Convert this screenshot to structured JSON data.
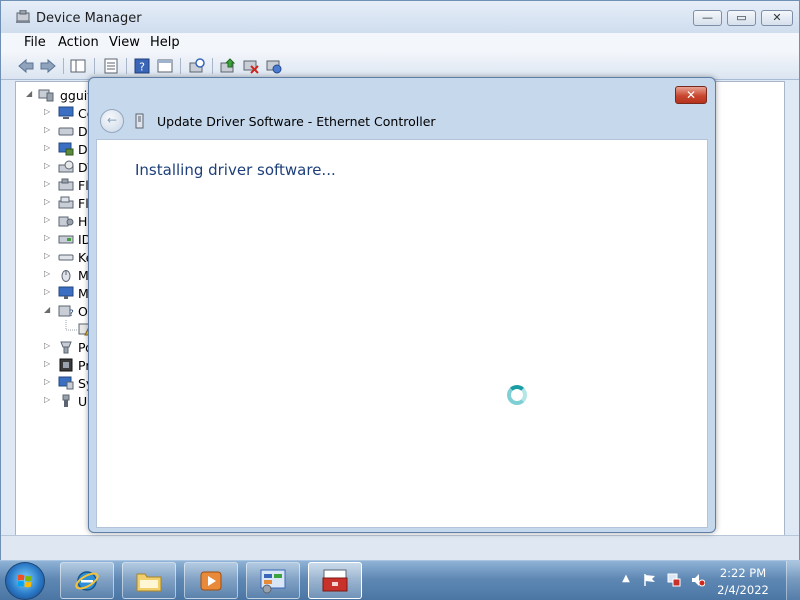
{
  "window": {
    "title": "Device Manager",
    "buttons": {
      "minimize": "—",
      "maximize": "▭",
      "close": "✕"
    }
  },
  "menu": {
    "items": [
      "File",
      "Action",
      "View",
      "Help"
    ]
  },
  "toolbar": {
    "icons": [
      "back-arrow-icon",
      "forward-arrow-icon",
      "console-tree-icon",
      "properties-icon",
      "help-icon",
      "show-hide-icon",
      "scan-hardware-icon",
      "update-driver-icon",
      "disable-device-icon",
      "uninstall-device-icon"
    ]
  },
  "tree": {
    "root": {
      "label": "gguiti",
      "arrow": "◢"
    },
    "items": [
      {
        "label": "Co",
        "arrow": "▷",
        "icon": "computer-icon"
      },
      {
        "label": "Di",
        "arrow": "▷",
        "icon": "disk-drive-icon"
      },
      {
        "label": "Di",
        "arrow": "▷",
        "icon": "display-adapter-icon"
      },
      {
        "label": "DV",
        "arrow": "▷",
        "icon": "dvd-drive-icon"
      },
      {
        "label": "Fl",
        "arrow": "▷",
        "icon": "floppy-controller-icon"
      },
      {
        "label": "Fl",
        "arrow": "▷",
        "icon": "floppy-drive-icon"
      },
      {
        "label": "Hu",
        "arrow": "▷",
        "icon": "hid-icon"
      },
      {
        "label": "ID",
        "arrow": "▷",
        "icon": "ide-controller-icon"
      },
      {
        "label": "Ke",
        "arrow": "▷",
        "icon": "keyboard-icon"
      },
      {
        "label": "Mi",
        "arrow": "▷",
        "icon": "mouse-icon"
      },
      {
        "label": "Mo",
        "arrow": "▷",
        "icon": "monitor-icon"
      },
      {
        "label": "Ot",
        "arrow": "◢",
        "icon": "other-devices-icon"
      },
      {
        "label": "",
        "arrow": "",
        "icon": "warning-device-icon"
      },
      {
        "label": "Po",
        "arrow": "▷",
        "icon": "ports-icon"
      },
      {
        "label": "Pr",
        "arrow": "▷",
        "icon": "processor-icon"
      },
      {
        "label": "Sy",
        "arrow": "▷",
        "icon": "system-devices-icon"
      },
      {
        "label": "Ur",
        "arrow": "▷",
        "icon": "usb-controller-icon"
      }
    ]
  },
  "dialog": {
    "title": "Update Driver Software - Ethernet Controller",
    "heading": "Installing driver software...",
    "close_label": "✕",
    "back_label": "←"
  },
  "taskbar": {
    "apps": [
      "internet-explorer-icon",
      "windows-explorer-icon",
      "media-player-icon",
      "control-panel-icon",
      "device-manager-toolbox-icon"
    ],
    "tray_icons": [
      "show-hidden-icons-arrow-icon",
      "action-center-flag-icon",
      "network-icon",
      "volume-muted-icon"
    ],
    "tray_arrow": "▲",
    "time": "2:22 PM",
    "date": "2/4/2022"
  }
}
